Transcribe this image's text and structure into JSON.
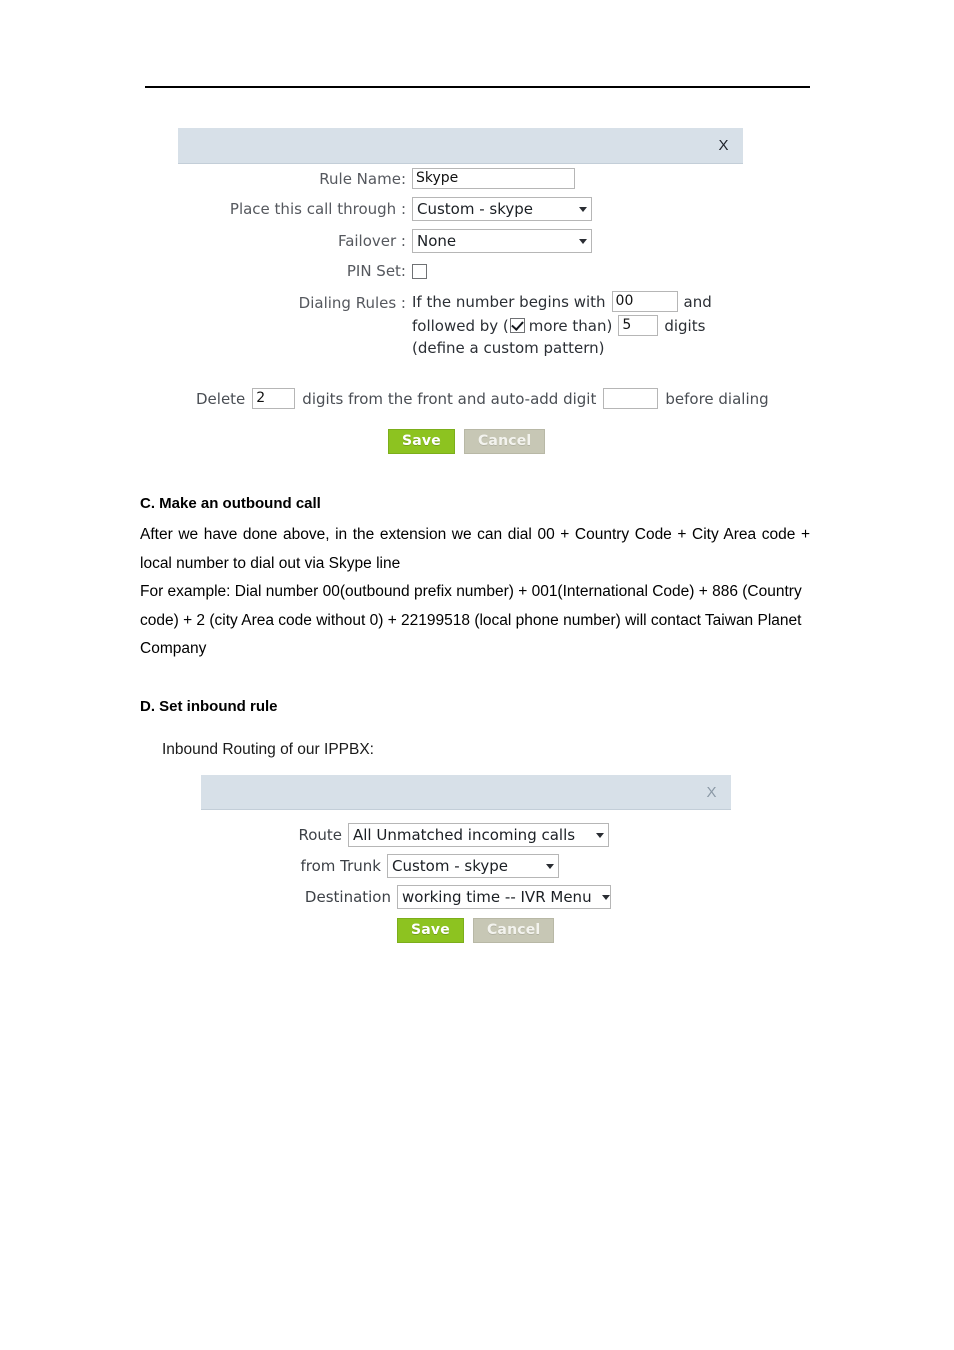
{
  "document": {
    "top_rule": true
  },
  "outbound_dialog": {
    "close_label": "X",
    "fields": {
      "rule_name": {
        "label": "Rule Name:",
        "value": "Skype"
      },
      "place_call_through": {
        "label": "Place this call through :",
        "value": "Custom - skype"
      },
      "failover": {
        "label": "Failover :",
        "value": "None"
      },
      "pin_set": {
        "label": "PIN Set:",
        "checked": false
      },
      "dialing_rules": {
        "label": "Dialing Rules :",
        "line1_prefix": "If the number begins with",
        "begins_with_value": "00",
        "line1_suffix": "and",
        "line2_prefix": "followed by (",
        "more_than_checked": true,
        "line2_mid": "more than)",
        "digits_value": "5",
        "line2_suffix": "digits",
        "line3": "(define a custom pattern)"
      }
    },
    "delete_row": {
      "prefix": "Delete",
      "delete_digits_value": "2",
      "middle": "digits from the front and auto-add digit",
      "auto_add_value": "",
      "suffix": "before dialing"
    },
    "buttons": {
      "save": "Save",
      "cancel": "Cancel"
    }
  },
  "section_c": {
    "heading": "C. Make an outbound call",
    "paragraph1": "After we have done above, in the extension we can dial 00 + Country Code + City Area code + local number to dial out via Skype line",
    "paragraph2": "For example: Dial number 00(outbound prefix number) + 001(International Code) + 886 (Country code) + 2 (city Area code without 0) + 22199518 (local phone number) will contact Taiwan Planet Company"
  },
  "section_d": {
    "heading": "D. Set inbound rule",
    "caption": "Inbound Routing of our IPPBX:"
  },
  "inbound_dialog": {
    "close_label": "X",
    "fields": {
      "route": {
        "label": "Route",
        "value": "All Unmatched incoming calls"
      },
      "from_trunk": {
        "label": "from Trunk",
        "value": "Custom - skype"
      },
      "destination": {
        "label": "Destination",
        "value": "working time -- IVR Menu"
      }
    },
    "buttons": {
      "save": "Save",
      "cancel": "Cancel"
    }
  },
  "colors": {
    "dialog_header": "#d7e0e8",
    "save_button": "#8dc320",
    "cancel_button": "#c7c7b5",
    "rule_line": "#000000"
  }
}
